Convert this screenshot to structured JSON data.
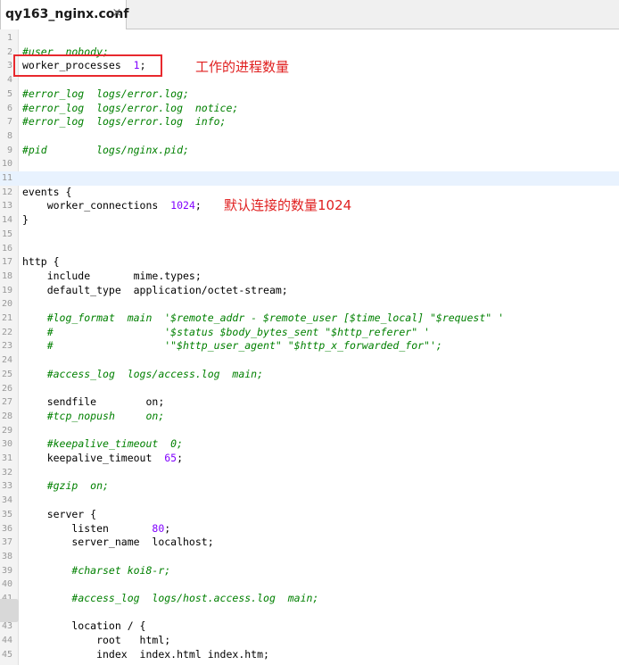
{
  "tab": {
    "title": "qy163_nginx.conf",
    "close_glyph": "×"
  },
  "annotations": {
    "worker_processes": "工作的进程数量",
    "worker_connections": "默认连接的数量1024"
  },
  "colors": {
    "comment": "#008000",
    "number": "#8000ff",
    "annotation": "#e02020",
    "highlight_border": "#e8292e",
    "current_line": "#e8f2fe"
  },
  "editor": {
    "current_line": 11,
    "lines": [
      {
        "n": "1",
        "code": ""
      },
      {
        "n": "2",
        "code": "#user  nobody;"
      },
      {
        "n": "3",
        "code": "worker_processes  1;"
      },
      {
        "n": "4",
        "code": ""
      },
      {
        "n": "5",
        "code": "#error_log  logs/error.log;"
      },
      {
        "n": "6",
        "code": "#error_log  logs/error.log  notice;"
      },
      {
        "n": "7",
        "code": "#error_log  logs/error.log  info;"
      },
      {
        "n": "8",
        "code": ""
      },
      {
        "n": "9",
        "code": "#pid        logs/nginx.pid;"
      },
      {
        "n": "10",
        "code": ""
      },
      {
        "n": "11",
        "code": ""
      },
      {
        "n": "12",
        "code": "events {"
      },
      {
        "n": "13",
        "code": "    worker_connections  1024;"
      },
      {
        "n": "14",
        "code": "}"
      },
      {
        "n": "15",
        "code": ""
      },
      {
        "n": "16",
        "code": ""
      },
      {
        "n": "17",
        "code": "http {"
      },
      {
        "n": "18",
        "code": "    include       mime.types;"
      },
      {
        "n": "19",
        "code": "    default_type  application/octet-stream;"
      },
      {
        "n": "20",
        "code": ""
      },
      {
        "n": "21",
        "code": "    #log_format  main  '$remote_addr - $remote_user [$time_local] \"$request\" '"
      },
      {
        "n": "22",
        "code": "    #                  '$status $body_bytes_sent \"$http_referer\" '"
      },
      {
        "n": "23",
        "code": "    #                  '\"$http_user_agent\" \"$http_x_forwarded_for\"';"
      },
      {
        "n": "24",
        "code": ""
      },
      {
        "n": "25",
        "code": "    #access_log  logs/access.log  main;"
      },
      {
        "n": "26",
        "code": ""
      },
      {
        "n": "27",
        "code": "    sendfile        on;"
      },
      {
        "n": "28",
        "code": "    #tcp_nopush     on;"
      },
      {
        "n": "29",
        "code": ""
      },
      {
        "n": "30",
        "code": "    #keepalive_timeout  0;"
      },
      {
        "n": "31",
        "code": "    keepalive_timeout  65;"
      },
      {
        "n": "32",
        "code": ""
      },
      {
        "n": "33",
        "code": "    #gzip  on;"
      },
      {
        "n": "34",
        "code": ""
      },
      {
        "n": "35",
        "code": "    server {"
      },
      {
        "n": "36",
        "code": "        listen       80;"
      },
      {
        "n": "37",
        "code": "        server_name  localhost;"
      },
      {
        "n": "38",
        "code": ""
      },
      {
        "n": "39",
        "code": "        #charset koi8-r;"
      },
      {
        "n": "40",
        "code": ""
      },
      {
        "n": "41",
        "code": "        #access_log  logs/host.access.log  main;"
      },
      {
        "n": "42",
        "code": ""
      },
      {
        "n": "43",
        "code": "        location / {"
      },
      {
        "n": "44",
        "code": "            root   html;"
      },
      {
        "n": "45",
        "code": "            index  index.html index.htm;"
      }
    ]
  }
}
